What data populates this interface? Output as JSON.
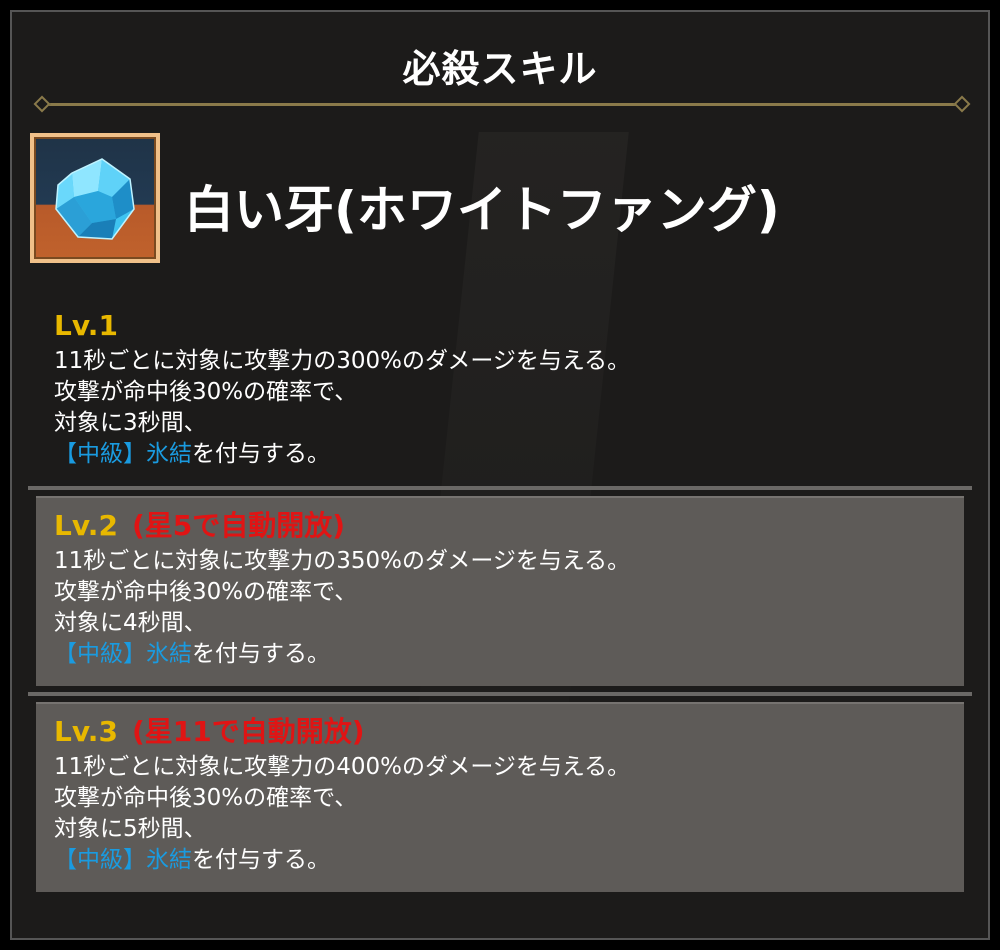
{
  "header": {
    "title": "必殺スキル"
  },
  "skill": {
    "icon": "ice-crystal-icon",
    "name": "白い牙(ホワイトファング)"
  },
  "levels": [
    {
      "label": "Lv.1",
      "unlock": "",
      "lines": [
        "11秒ごとに対象に攻撃力の300%のダメージを与える。",
        "攻撃が命中後30%の確率で、",
        "対象に3秒間、"
      ],
      "status_tag": "【中級】",
      "status_name": "氷結",
      "status_suffix": "を付与する。"
    },
    {
      "label": "Lv.2",
      "unlock": "(星5で自動開放)",
      "lines": [
        "11秒ごとに対象に攻撃力の350%のダメージを与える。",
        "攻撃が命中後30%の確率で、",
        "対象に4秒間、"
      ],
      "status_tag": "【中級】",
      "status_name": "氷結",
      "status_suffix": "を付与する。"
    },
    {
      "label": "Lv.3",
      "unlock": "(星11で自動開放)",
      "lines": [
        "11秒ごとに対象に攻撃力の400%のダメージを与える。",
        "攻撃が命中後30%の確率で、",
        "対象に5秒間、"
      ],
      "status_tag": "【中級】",
      "status_name": "氷結",
      "status_suffix": "を付与する。"
    }
  ],
  "colors": {
    "level_label": "#e8b800",
    "unlock_text": "#e01414",
    "status_text": "#1a9be0",
    "divider": "#8a7a4a"
  }
}
